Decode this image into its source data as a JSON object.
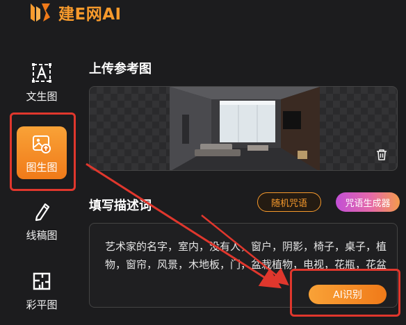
{
  "app": {
    "title": "建E网AI"
  },
  "sidebar": {
    "items": [
      {
        "label": "文生图",
        "icon": "text-to-image-icon",
        "active": false
      },
      {
        "label": "图生图",
        "icon": "image-to-image-icon",
        "active": true
      },
      {
        "label": "线稿图",
        "icon": "pen-sketch-icon",
        "active": false
      },
      {
        "label": "彩平图",
        "icon": "floor-plan-icon",
        "active": false
      }
    ]
  },
  "upload": {
    "title": "上传参考图",
    "delete_icon": "trash-icon"
  },
  "description": {
    "title": "填写描述词",
    "random_label": "随机咒语",
    "generator_label": "咒语生成器",
    "text": "艺术家的名字，室内，没有人，窗户，阴影，椅子，桌子，植物，窗帘，风景，木地板，门，盆栽植物，电视，花瓶，花盆",
    "ai_button_label": "AI识别"
  },
  "colors": {
    "accent": "#f79a2c",
    "background": "#1c1c1e",
    "annotation": "#e0372d",
    "generator_gradient": [
      "#c24fd6",
      "#f39a4d"
    ]
  }
}
